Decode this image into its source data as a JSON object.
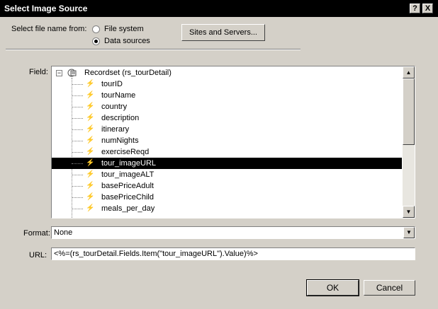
{
  "window": {
    "title": "Select Image Source",
    "help_btn": "?",
    "close_btn": "X"
  },
  "select_from": {
    "label": "Select file name from:",
    "options": [
      "File system",
      "Data sources"
    ],
    "selected": "Data sources"
  },
  "sites_button": "Sites and Servers...",
  "field": {
    "label": "Field:",
    "root": "Recordset (rs_tourDetail)",
    "items": [
      "tourID",
      "tourName",
      "country",
      "description",
      "itinerary",
      "numNights",
      "exerciseReqd",
      "tour_imageURL",
      "tour_imageALT",
      "basePriceAdult",
      "basePriceChild",
      "meals_per_day"
    ],
    "selected": "tour_imageURL",
    "scroll_up_icon": "triangle-up",
    "scroll_down_icon": "triangle-down"
  },
  "format": {
    "label": "Format:",
    "value": "None"
  },
  "url": {
    "label": "URL:",
    "value": "<%=(rs_tourDetail.Fields.Item(\"tour_imageURL\").Value)%>"
  },
  "buttons": {
    "ok": "OK",
    "cancel": "Cancel"
  }
}
